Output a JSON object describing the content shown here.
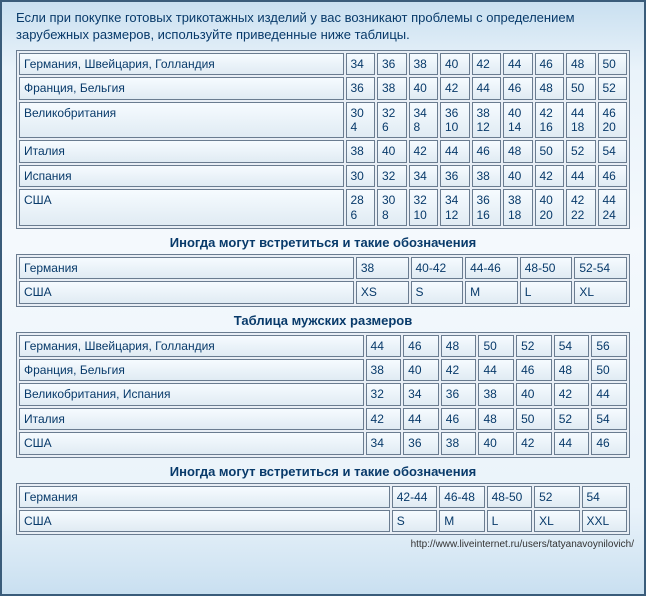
{
  "intro": "Если при покупке готовых трикотажных изделий у вас возникают проблемы с определением зарубежных размеров, используйте приведенные ниже таблицы.",
  "heading_alt1": "Иногда могут встретиться и такие обозначения",
  "heading_men": "Таблица мужских размеров",
  "heading_alt2": "Иногда могут встретиться и такие обозначения",
  "footer": "http://www.liveinternet.ru/users/tatyanavoynilovich/",
  "t1": {
    "rows": [
      {
        "label": "Германия, Швейцария, Голландия",
        "vals": [
          "34",
          "36",
          "38",
          "40",
          "42",
          "44",
          "46",
          "48",
          "50"
        ]
      },
      {
        "label": "Франция, Бельгия",
        "vals": [
          "36",
          "38",
          "40",
          "42",
          "44",
          "46",
          "48",
          "50",
          "52"
        ]
      },
      {
        "label": "Великобритания",
        "vals": [
          "30 4",
          "32 6",
          "34 8",
          "36 10",
          "38 12",
          "40 14",
          "42 16",
          "44 18",
          "46 20"
        ]
      },
      {
        "label": "Италия",
        "vals": [
          "38",
          "40",
          "42",
          "44",
          "46",
          "48",
          "50",
          "52",
          "54"
        ]
      },
      {
        "label": "Испания",
        "vals": [
          "30",
          "32",
          "34",
          "36",
          "38",
          "40",
          "42",
          "44",
          "46"
        ]
      },
      {
        "label": "США",
        "vals": [
          "28 6",
          "30 8",
          "32 10",
          "34 12",
          "36 16",
          "38 18",
          "40 20",
          "42 22",
          "44 24"
        ]
      }
    ]
  },
  "t2": {
    "rows": [
      {
        "label": "Германия",
        "vals": [
          "38",
          "40-42",
          "44-46",
          "48-50",
          "52-54"
        ]
      },
      {
        "label": "США",
        "vals": [
          "XS",
          "S",
          "M",
          "L",
          "XL"
        ]
      }
    ]
  },
  "t3": {
    "rows": [
      {
        "label": "Германия, Швейцария, Голландия",
        "vals": [
          "44",
          "46",
          "48",
          "50",
          "52",
          "54",
          "56"
        ]
      },
      {
        "label": "Франция, Бельгия",
        "vals": [
          "38",
          "40",
          "42",
          "44",
          "46",
          "48",
          "50"
        ]
      },
      {
        "label": "Великобритания, Испания",
        "vals": [
          "32",
          "34",
          "36",
          "38",
          "40",
          "42",
          "44"
        ]
      },
      {
        "label": "Италия",
        "vals": [
          "42",
          "44",
          "46",
          "48",
          "50",
          "52",
          "54"
        ]
      },
      {
        "label": "США",
        "vals": [
          "34",
          "36",
          "38",
          "40",
          "42",
          "44",
          "46"
        ]
      }
    ]
  },
  "t4": {
    "rows": [
      {
        "label": "Германия",
        "vals": [
          "42-44",
          "46-48",
          "48-50",
          "52",
          "54"
        ]
      },
      {
        "label": "США",
        "vals": [
          "S",
          "M",
          "L",
          "XL",
          "XXL"
        ]
      }
    ]
  }
}
